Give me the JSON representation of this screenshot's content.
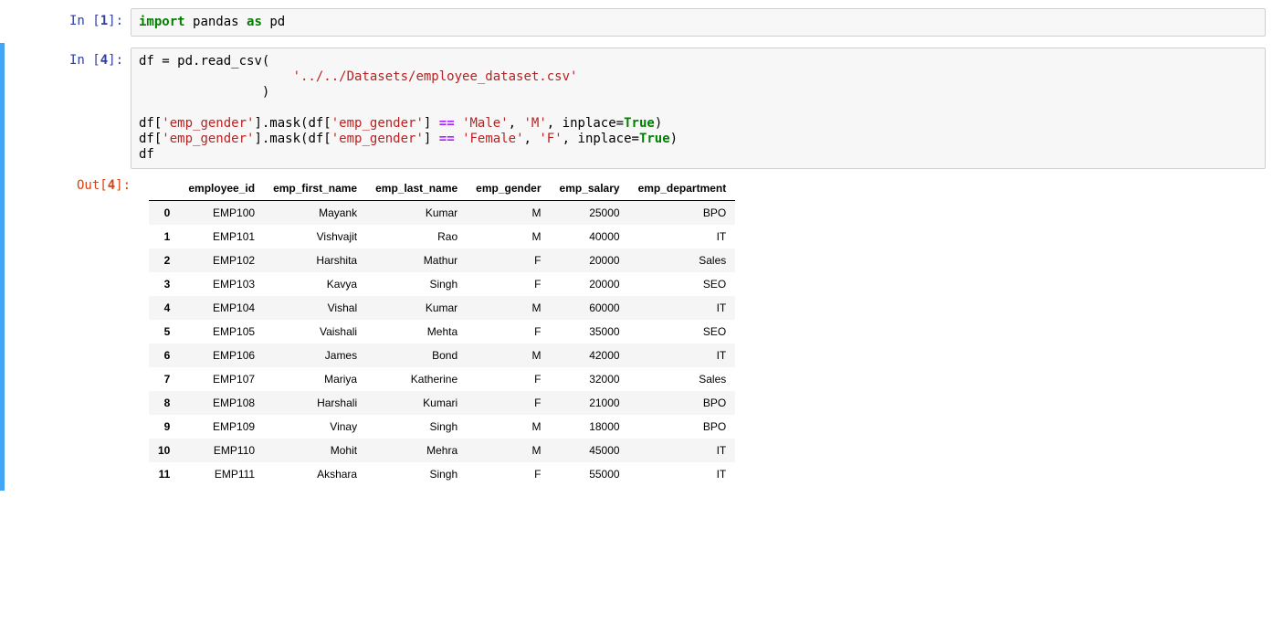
{
  "cells": [
    {
      "prompt_label": "In",
      "prompt_num": "1",
      "code_tokens": [
        {
          "t": "import",
          "c": "kw"
        },
        {
          "t": " "
        },
        {
          "t": "pandas",
          "c": "nm"
        },
        {
          "t": " "
        },
        {
          "t": "as",
          "c": "kw"
        },
        {
          "t": " "
        },
        {
          "t": "pd",
          "c": "nm"
        }
      ]
    },
    {
      "prompt_label": "In",
      "prompt_num": "4",
      "code_tokens": [
        {
          "t": "df "
        },
        {
          "t": "="
        },
        {
          "t": " pd.read_csv(\n"
        },
        {
          "t": "                    "
        },
        {
          "t": "'../../Datasets/employee_dataset.csv'",
          "c": "str"
        },
        {
          "t": "\n"
        },
        {
          "t": "                )\n\n"
        },
        {
          "t": "df["
        },
        {
          "t": "'emp_gender'",
          "c": "str"
        },
        {
          "t": "].mask(df["
        },
        {
          "t": "'emp_gender'",
          "c": "str"
        },
        {
          "t": "] "
        },
        {
          "t": "==",
          "c": "op"
        },
        {
          "t": " "
        },
        {
          "t": "'Male'",
          "c": "str"
        },
        {
          "t": ", "
        },
        {
          "t": "'M'",
          "c": "str"
        },
        {
          "t": ", inplace"
        },
        {
          "t": "="
        },
        {
          "t": "True",
          "c": "kw"
        },
        {
          "t": ")\n"
        },
        {
          "t": "df["
        },
        {
          "t": "'emp_gender'",
          "c": "str"
        },
        {
          "t": "].mask(df["
        },
        {
          "t": "'emp_gender'",
          "c": "str"
        },
        {
          "t": "] "
        },
        {
          "t": "==",
          "c": "op"
        },
        {
          "t": " "
        },
        {
          "t": "'Female'",
          "c": "str"
        },
        {
          "t": ", "
        },
        {
          "t": "'F'",
          "c": "str"
        },
        {
          "t": ", inplace"
        },
        {
          "t": "="
        },
        {
          "t": "True",
          "c": "kw"
        },
        {
          "t": ")\n"
        },
        {
          "t": "df"
        }
      ],
      "output": {
        "prompt_label": "Out",
        "prompt_num": "4",
        "dataframe": {
          "columns": [
            "employee_id",
            "emp_first_name",
            "emp_last_name",
            "emp_gender",
            "emp_salary",
            "emp_department"
          ],
          "index": [
            "0",
            "1",
            "2",
            "3",
            "4",
            "5",
            "6",
            "7",
            "8",
            "9",
            "10",
            "11"
          ],
          "rows": [
            [
              "EMP100",
              "Mayank",
              "Kumar",
              "M",
              "25000",
              "BPO"
            ],
            [
              "EMP101",
              "Vishvajit",
              "Rao",
              "M",
              "40000",
              "IT"
            ],
            [
              "EMP102",
              "Harshita",
              "Mathur",
              "F",
              "20000",
              "Sales"
            ],
            [
              "EMP103",
              "Kavya",
              "Singh",
              "F",
              "20000",
              "SEO"
            ],
            [
              "EMP104",
              "Vishal",
              "Kumar",
              "M",
              "60000",
              "IT"
            ],
            [
              "EMP105",
              "Vaishali",
              "Mehta",
              "F",
              "35000",
              "SEO"
            ],
            [
              "EMP106",
              "James",
              "Bond",
              "M",
              "42000",
              "IT"
            ],
            [
              "EMP107",
              "Mariya",
              "Katherine",
              "F",
              "32000",
              "Sales"
            ],
            [
              "EMP108",
              "Harshali",
              "Kumari",
              "F",
              "21000",
              "BPO"
            ],
            [
              "EMP109",
              "Vinay",
              "Singh",
              "M",
              "18000",
              "BPO"
            ],
            [
              "EMP110",
              "Mohit",
              "Mehra",
              "M",
              "45000",
              "IT"
            ],
            [
              "EMP111",
              "Akshara",
              "Singh",
              "F",
              "55000",
              "IT"
            ]
          ]
        }
      }
    }
  ]
}
